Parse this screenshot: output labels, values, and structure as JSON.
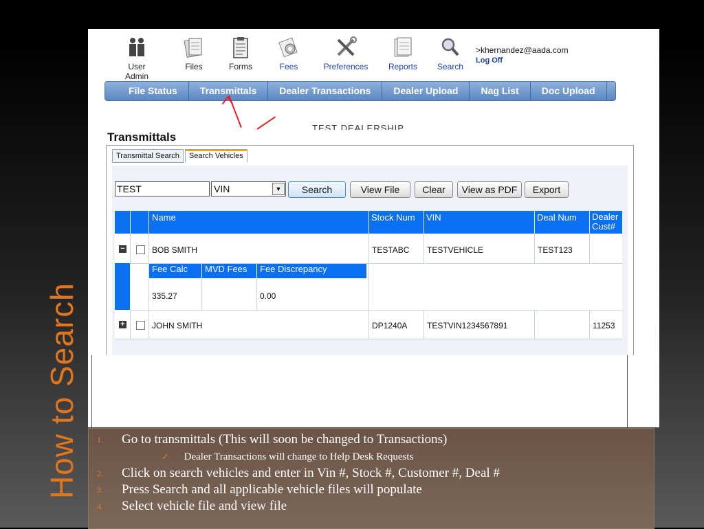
{
  "slide": {
    "vertical_title": "How to Search"
  },
  "toolbar": {
    "items": [
      {
        "label": "User Admin",
        "icon": "users-icon"
      },
      {
        "label": "Files",
        "icon": "files-icon"
      },
      {
        "label": "Forms",
        "icon": "clipboard-icon"
      },
      {
        "label": "Fees",
        "icon": "gear-icon"
      },
      {
        "label": "Preferences",
        "icon": "tools-icon"
      },
      {
        "label": "Reports",
        "icon": "reports-icon"
      },
      {
        "label": "Search",
        "icon": "magnifier-icon"
      }
    ],
    "user_email": ">khernandez@aada.com",
    "logoff": "Log Off"
  },
  "nav": {
    "items": [
      "File Status",
      "Transmittals",
      "Dealer Transactions",
      "Dealer Upload",
      "Nag List",
      "Doc Upload"
    ]
  },
  "dealership": "TEST DEALERSHIP",
  "section_title": "Transmittals",
  "tabs": [
    "Transmittal Search",
    "Search Vehicles"
  ],
  "search": {
    "value": "TEST",
    "field_selected": "VIN",
    "buttons": [
      "Search",
      "View File",
      "Clear",
      "View as PDF",
      "Export"
    ]
  },
  "table": {
    "headers": [
      "Name",
      "Stock Num",
      "VIN",
      "Deal Num",
      "Dealer Cust#"
    ],
    "rows": [
      {
        "name": "BOB SMITH",
        "stock": "TESTABC",
        "vin": "TESTVEHICLE",
        "deal": "TEST123",
        "cust": "",
        "expanded": "−"
      },
      {
        "name": "JOHN SMITH",
        "stock": "DP1240A",
        "vin": "TESTVIN1234567891",
        "deal": "",
        "cust": "11253",
        "expanded": "+"
      }
    ],
    "subtable": {
      "headers": [
        "Fee Calc",
        "MVD Fees",
        "Fee Discrepancy"
      ],
      "values": [
        "335.27",
        "",
        "0.00"
      ]
    }
  },
  "steps": [
    {
      "num": "1.",
      "text": "Go to transmittals (This will soon be changed to Transactions)"
    },
    {
      "num": "2.",
      "text": "Click on search vehicles and enter in Vin #, Stock #, Customer #, Deal #"
    },
    {
      "num": "3.",
      "text": "Press Search and all applicable vehicle files will populate"
    },
    {
      "num": "4.",
      "text": "Select vehicle file and view file"
    }
  ],
  "substep": "Dealer Transactions will change to Help Desk Requests",
  "colors": {
    "accent": "#e0771f",
    "grid_header": "#0a6ff0",
    "nav": "#5c88c4",
    "arrow": "#e02020"
  }
}
